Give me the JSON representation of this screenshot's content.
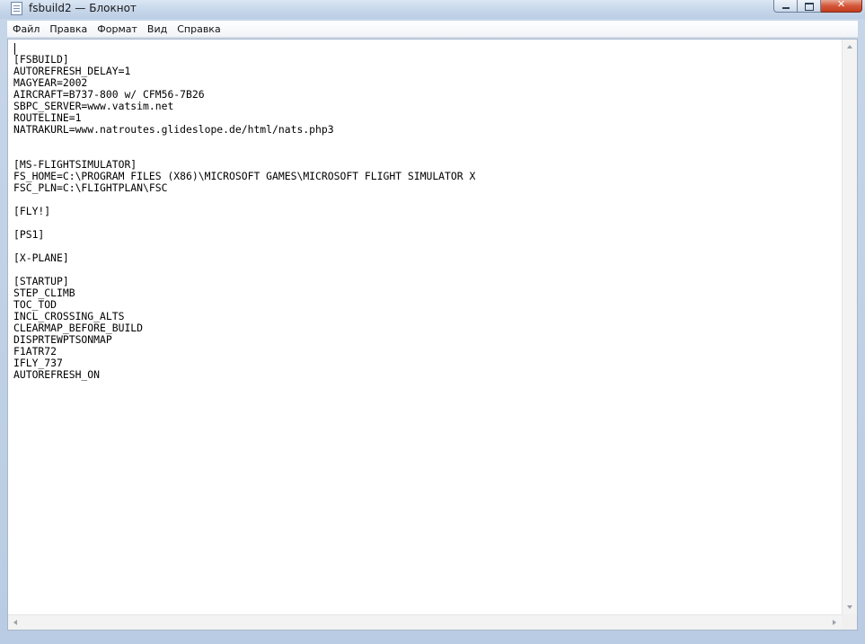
{
  "window": {
    "title": "fsbuild2 — Блокнот",
    "icon": "notepad-icon"
  },
  "menu": {
    "items": [
      {
        "label": "Файл"
      },
      {
        "label": "Правка"
      },
      {
        "label": "Формат"
      },
      {
        "label": "Вид"
      },
      {
        "label": "Справка"
      }
    ]
  },
  "editor": {
    "lines": [
      "",
      "[FSBUILD]",
      "AUTOREFRESH_DELAY=1",
      "MAGYEAR=2002",
      "AIRCRAFT=B737-800 w/ CFM56-7B26",
      "SBPC_SERVER=www.vatsim.net",
      "ROUTELINE=1",
      "NATRAKURL=www.natroutes.glideslope.de/html/nats.php3",
      "",
      "",
      "[MS-FLIGHTSIMULATOR]",
      "FS_HOME=C:\\PROGRAM FILES (X86)\\MICROSOFT GAMES\\MICROSOFT FLIGHT SIMULATOR X",
      "FSC_PLN=C:\\FLIGHTPLAN\\FSC",
      "",
      "[FLY!]",
      "",
      "[PS1]",
      "",
      "[X-PLANE]",
      "",
      "[STARTUP]",
      "STEP_CLIMB",
      "TOC_TOD",
      "INCL_CROSSING_ALTS",
      "CLEARMAP_BEFORE_BUILD",
      "DISPRTEWPTSONMAP",
      "F1ATR72",
      "IFLY_737",
      "AUTOREFRESH_ON"
    ]
  }
}
